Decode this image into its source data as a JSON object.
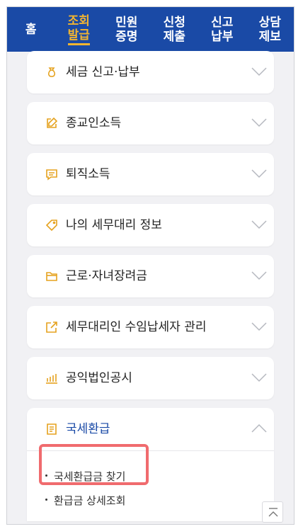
{
  "nav": {
    "items": [
      {
        "label": "홈",
        "active": false
      },
      {
        "label": "조회\n발급",
        "active": true
      },
      {
        "label": "민원\n증명",
        "active": false
      },
      {
        "label": "신청\n제출",
        "active": false
      },
      {
        "label": "신고\n납부",
        "active": false
      },
      {
        "label": "상담\n제보",
        "active": false
      }
    ]
  },
  "menu": {
    "items": [
      {
        "label": "세금 신고·납부",
        "icon": "money-bag-icon"
      },
      {
        "label": "종교인소득",
        "icon": "edit-icon"
      },
      {
        "label": "퇴직소득",
        "icon": "message-icon"
      },
      {
        "label": "나의 세무대리 정보",
        "icon": "tag-icon"
      },
      {
        "label": "근로·자녀장려금",
        "icon": "folder-icon"
      },
      {
        "label": "세무대리인 수임납세자 관리",
        "icon": "external-link-icon"
      },
      {
        "label": "공익법인공시",
        "icon": "bar-chart-icon"
      }
    ],
    "expanded": {
      "label": "국세환급",
      "icon": "receipt-icon",
      "subitems": [
        "국세환급금 찾기",
        "환급금 상세조회"
      ]
    }
  },
  "colors": {
    "nav_bg": "#1a4aa6",
    "accent": "#f2b530",
    "highlight": "#f06b6e",
    "icon": "#e5a21e"
  }
}
